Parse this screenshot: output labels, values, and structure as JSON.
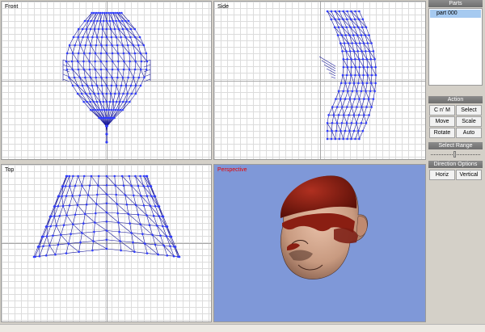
{
  "viewports": {
    "front": "Front",
    "side": "Side",
    "top": "Top",
    "perspective": "Perspective"
  },
  "parts": {
    "title": "Parts",
    "items": [
      "part 000"
    ]
  },
  "action": {
    "title": "Action",
    "buttons": {
      "cnm": "C n' M",
      "select": "Select",
      "move": "Move",
      "scale": "Scale",
      "rotate": "Rotate",
      "auto": "Auto"
    }
  },
  "select_range": {
    "title": "Select Range",
    "level": 0.5
  },
  "direction_options": {
    "title": "Direction Options",
    "horiz": "Horiz",
    "vertical": "Vertical"
  },
  "colors": {
    "wire": "#1a1a9a",
    "vertex": "#2f3cff",
    "perspective_bg": "#7f98d8",
    "skin": "#c89a80",
    "paint": "#8a1e12",
    "perspective_label": "#e60000"
  }
}
